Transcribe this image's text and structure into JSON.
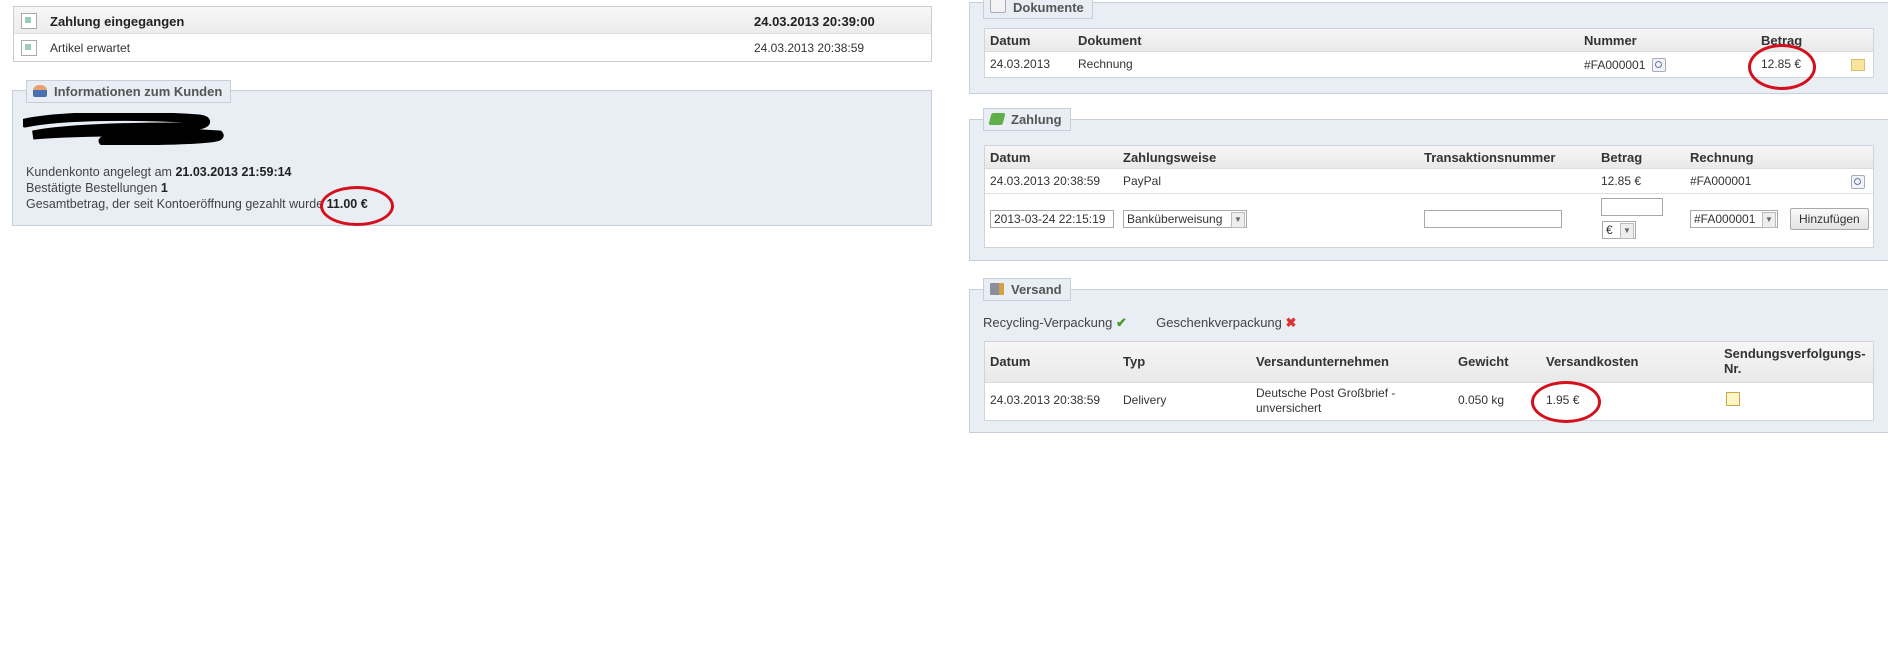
{
  "history": {
    "rows": [
      {
        "status": "Zahlung eingegangen",
        "date": "24.03.2013 20:39:00"
      },
      {
        "status": "Artikel erwartet",
        "date": "24.03.2013 20:38:59"
      }
    ]
  },
  "customer": {
    "title": "Informationen zum Kunden",
    "account_label": "Kundenkonto angelegt am",
    "account_date": "21.03.2013 21:59:14",
    "orders_label": "Bestätigte Bestellungen",
    "orders_count": "1",
    "total_label": "Gesamtbetrag, der seit Kontoeröffnung gezahlt wurde",
    "total_value": "11.00 €"
  },
  "documents": {
    "title": "Dokumente",
    "headers": [
      "Datum",
      "Dokument",
      "Nummer",
      "Betrag"
    ],
    "row": {
      "date": "24.03.2013",
      "document": "Rechnung",
      "number": "#FA000001",
      "amount": "12.85 €"
    }
  },
  "payment": {
    "title": "Zahlung",
    "headers": [
      "Datum",
      "Zahlungsweise",
      "Transaktionsnummer",
      "Betrag",
      "Rechnung"
    ],
    "row": {
      "date": "24.03.2013 20:38:59",
      "method": "PayPal",
      "transaction": "",
      "amount": "12.85 €",
      "invoice": "#FA000001"
    },
    "form": {
      "date_value": "2013-03-24 22:15:19",
      "method_value": "Banküberweisung",
      "transaction_value": "",
      "amount_value": "",
      "currency_value": "€",
      "invoice_value": "#FA000001",
      "add_label": "Hinzufügen"
    }
  },
  "shipping": {
    "title": "Versand",
    "recycling_label": "Recycling-Verpackung",
    "gift_label": "Geschenkverpackung",
    "headers": [
      "Datum",
      "Typ",
      "Versandunternehmen",
      "Gewicht",
      "Versandkosten",
      "Sendungsverfolgungs-Nr."
    ],
    "row": {
      "date": "24.03.2013 20:38:59",
      "type": "Delivery",
      "carrier": "Deutsche Post Großbrief - unversichert",
      "weight": "0.050 kg",
      "cost": "1.95 €"
    }
  },
  "colors": {
    "highlight": "#d3101c",
    "panel_bg": "#e9edf4",
    "check": "#4a9a2a",
    "cross": "#e03030"
  }
}
